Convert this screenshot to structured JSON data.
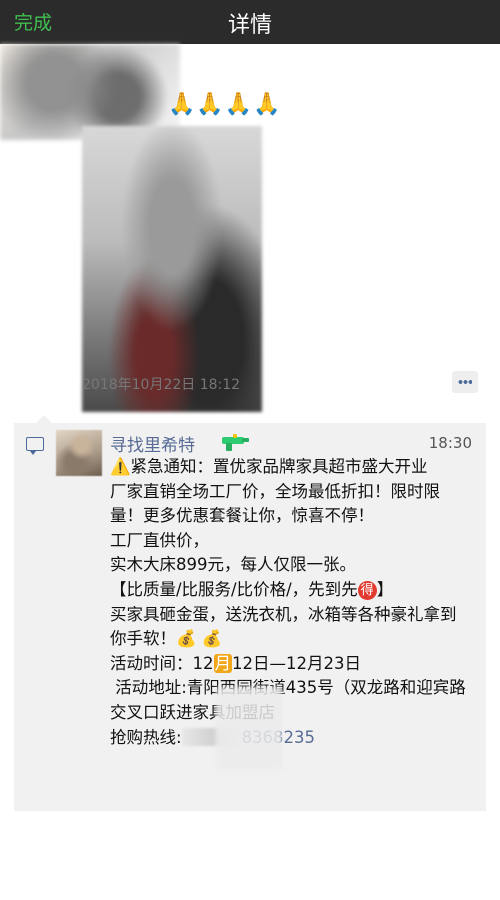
{
  "navbar": {
    "done_label": "完成",
    "title": "详情"
  },
  "post": {
    "reaction_emojis": "🙏🙏🙏🙏",
    "timestamp": "2018年10月22日 18:12"
  },
  "comment": {
    "author": "寻找里希特",
    "time": "18:30",
    "title": "紧急通知：置优家品牌家具超市盛大开业",
    "line1": "厂家直销全场工厂价，全场最低折扣！限时限量！更多优惠套餐让你，惊喜不停！",
    "line2": "工厂直供价，",
    "line3": "实木大床899元，每人仅限一张。",
    "line4_before": "【比质量/比服务/比价格/，先到先",
    "line4_badge": "得",
    "line4_after": "】",
    "line5": "买家具砸金蛋，送洗衣机，冰箱等各种豪礼拿到你手软！",
    "money_emojis": "💰 💰",
    "line6_before": "活动时间：12",
    "line6_chip": "月",
    "line6_after": "12日—12月23日",
    "line7": " 活动地址:青阳西园街道435号（双龙路和迎宾路交叉口跃进家具加盟店",
    "line8_label": "抢购热线:",
    "line8_number": "8368235"
  }
}
